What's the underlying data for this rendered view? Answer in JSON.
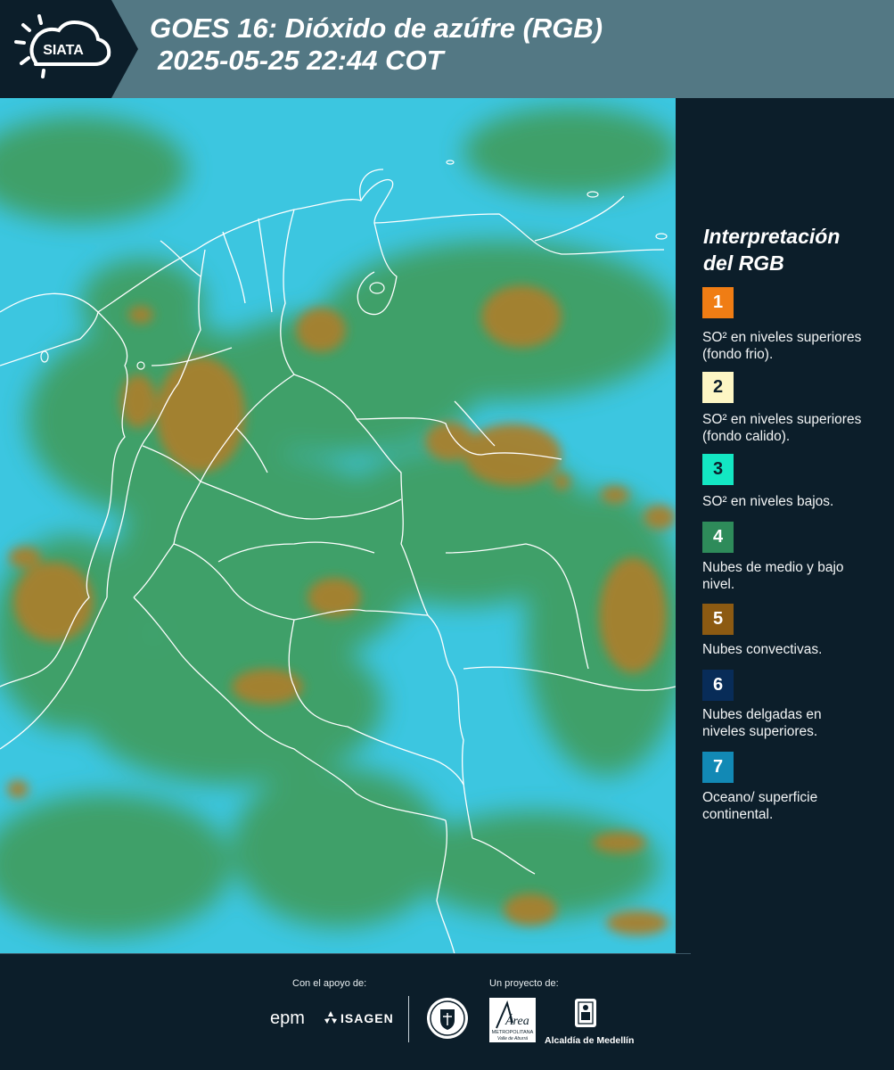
{
  "header": {
    "logo_text": "SIATA",
    "title_line1": "GOES 16: Dióxido de azúfre (RGB)",
    "title_line2": "2025-05-25 22:44 COT"
  },
  "legend": {
    "title_line1": "Interpretación",
    "title_line2": "del RGB",
    "items": [
      {
        "number": "1",
        "color": "#f07d14",
        "number_color": "#ffffff",
        "description": "SO² en niveles superiores (fondo frio)."
      },
      {
        "number": "2",
        "color": "#fdf6c4",
        "number_color": "#0c1e2a",
        "description": "SO² en niveles superiores (fondo calido)."
      },
      {
        "number": "3",
        "color": "#13e7c3",
        "number_color": "#0c1e2a",
        "description": "SO² en niveles bajos."
      },
      {
        "number": "4",
        "color": "#2e8b5a",
        "number_color": "#ffffff",
        "description": "Nubes de medio y bajo nivel."
      },
      {
        "number": "5",
        "color": "#8c5a12",
        "number_color": "#ffffff",
        "description": "Nubes convectivas."
      },
      {
        "number": "6",
        "color": "#082c58",
        "number_color": "#ffffff",
        "description": "Nubes delgadas en niveles superiores."
      },
      {
        "number": "7",
        "color": "#1289b5",
        "number_color": "#ffffff",
        "description": "Oceano/ superficie continental."
      }
    ]
  },
  "map": {
    "product": "GOES 16 Sulfur Dioxide RGB composite",
    "region": "Colombia and surroundings",
    "colors": {
      "ocean_surface": "#3cc6e0",
      "mid_low_cloud": "#3f9a55",
      "convective_cloud": "#a8802e",
      "borders": "#ffffff"
    }
  },
  "footer": {
    "support_label": "Con el apoyo de:",
    "project_label": "Un proyecto de:",
    "epm_logo": "epm",
    "isagen_logo": "ISAGEN",
    "area_logo_word": "Área",
    "area_logo_sub1": "METROPOLITANA",
    "area_logo_sub2": "Valle de Aburrá",
    "alcaldia_label": "Alcaldía de Medellín"
  }
}
